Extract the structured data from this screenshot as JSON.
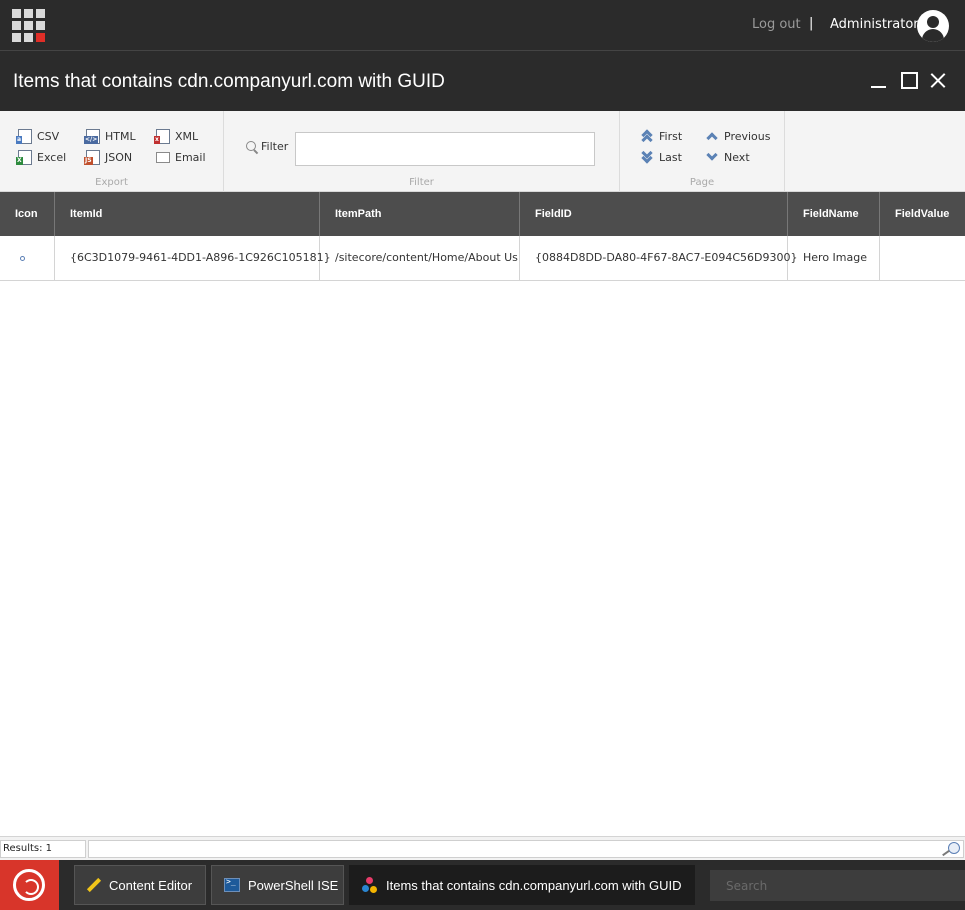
{
  "topbar": {
    "logout": "Log out",
    "separator": "|",
    "user": "Administrator"
  },
  "window": {
    "title": "Items that contains cdn.companyurl.com with GUID"
  },
  "ribbon": {
    "export": {
      "label": "Export",
      "csv": "CSV",
      "excel": "Excel",
      "html": "HTML",
      "json": "JSON",
      "xml": "XML",
      "email": "Email"
    },
    "filter": {
      "label": "Filter",
      "button": "Filter",
      "value": ""
    },
    "page": {
      "label": "Page",
      "first": "First",
      "last": "Last",
      "previous": "Previous",
      "next": "Next"
    }
  },
  "grid": {
    "columns": [
      "Icon",
      "ItemId",
      "ItemPath",
      "FieldID",
      "FieldName",
      "FieldValue"
    ],
    "rows": [
      {
        "item_id": "{6C3D1079-9461-4DD1-A896-1C926C105181}",
        "item_path": "/sitecore/content/Home/About Us",
        "field_id": "{0884D8DD-DA80-4F67-8AC7-E094C56D9300}",
        "field_name": "Hero Image",
        "field_value": ""
      }
    ]
  },
  "status": {
    "results": "Results: 1"
  },
  "taskbar": {
    "tasks": [
      "Content Editor",
      "PowerShell ISE",
      "Items that contains cdn.companyurl.com with GUID"
    ],
    "search_placeholder": "Search"
  },
  "colors": {
    "dark_bar": "#2b2b2b",
    "grid_header": "#4d4d4d",
    "start_red": "#d8352a",
    "accent_blue": "#5b82b5"
  },
  "icons": [
    "app-grid-icon",
    "user-avatar-icon",
    "csv-file-icon",
    "excel-file-icon",
    "html-file-icon",
    "json-file-icon",
    "xml-file-icon",
    "email-icon",
    "search-icon",
    "first-icon",
    "last-icon",
    "previous-icon",
    "next-icon",
    "item-icon",
    "powershell-icon",
    "pencil-icon",
    "sitecore-logo-icon"
  ]
}
